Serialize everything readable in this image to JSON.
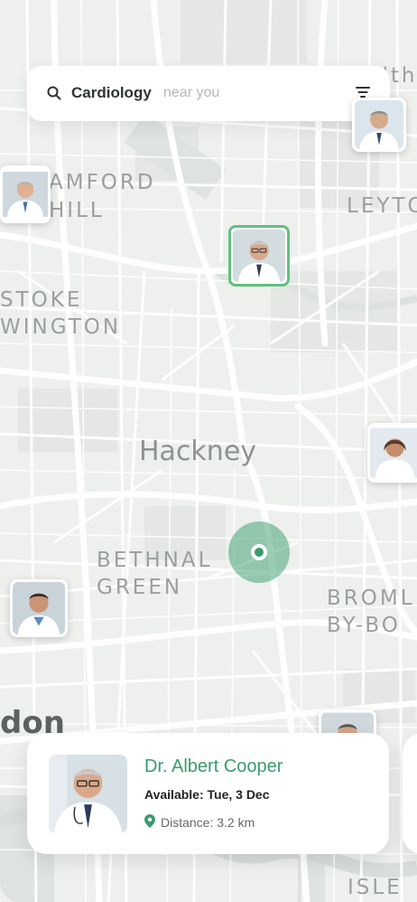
{
  "search": {
    "query": "Cardiology",
    "placeholder": "near you",
    "icon": "search-icon",
    "filter_icon": "filter-icon"
  },
  "map": {
    "labels": {
      "stamford_hill": "AMFORD\nHILL",
      "stoke_newington": "STOKE\nWINGTON",
      "leyton": "LEYTO",
      "walthamstow": "M  lthams",
      "hackney": "Hackney",
      "bethnal_green": "BETHNAL\nGREEN",
      "bromley_by_bow": "BROML\nBY-BO",
      "london": "don",
      "isle": "ISLE"
    }
  },
  "doctor_card": {
    "name": "Dr. Albert Cooper",
    "availability": "Available: Tue, 3 Dec",
    "distance": "Distance: 3.2 km"
  },
  "colors": {
    "accent": "#3a9a6e",
    "active_pin": "#5fc27e",
    "map_bg": "#eef0ee",
    "road": "#ffffff"
  }
}
